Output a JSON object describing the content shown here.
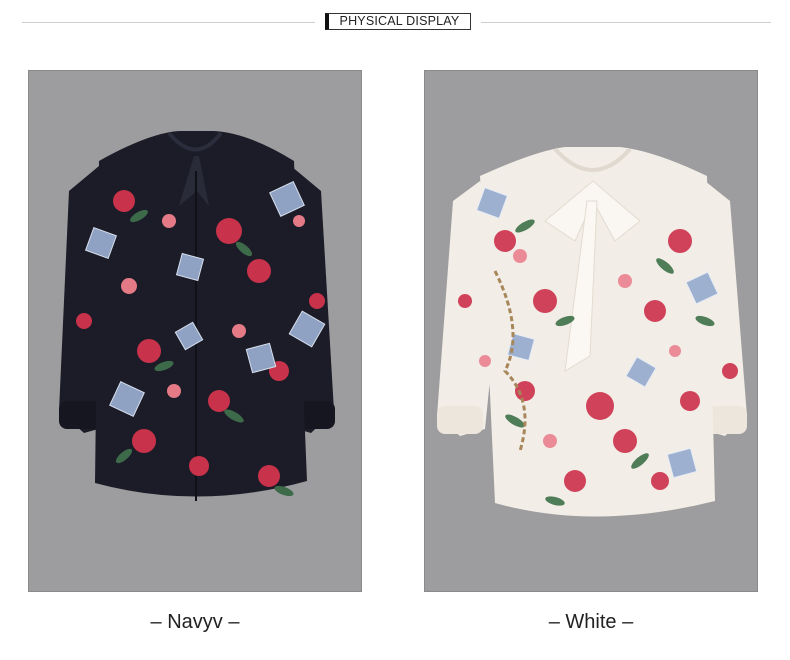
{
  "header": {
    "title": "PHYSICAL DISPLAY"
  },
  "products": [
    {
      "caption": "– Navyv –",
      "color_name": "Navyv",
      "garment_color": "#1b1c28",
      "print_accent": "#c8324a"
    },
    {
      "caption": "– White –",
      "color_name": "White",
      "garment_color": "#f2ede6",
      "print_accent": "#d0425a"
    }
  ],
  "colors": {
    "panel_background": "#9d9d9f",
    "rule": "#cfcfcf"
  }
}
